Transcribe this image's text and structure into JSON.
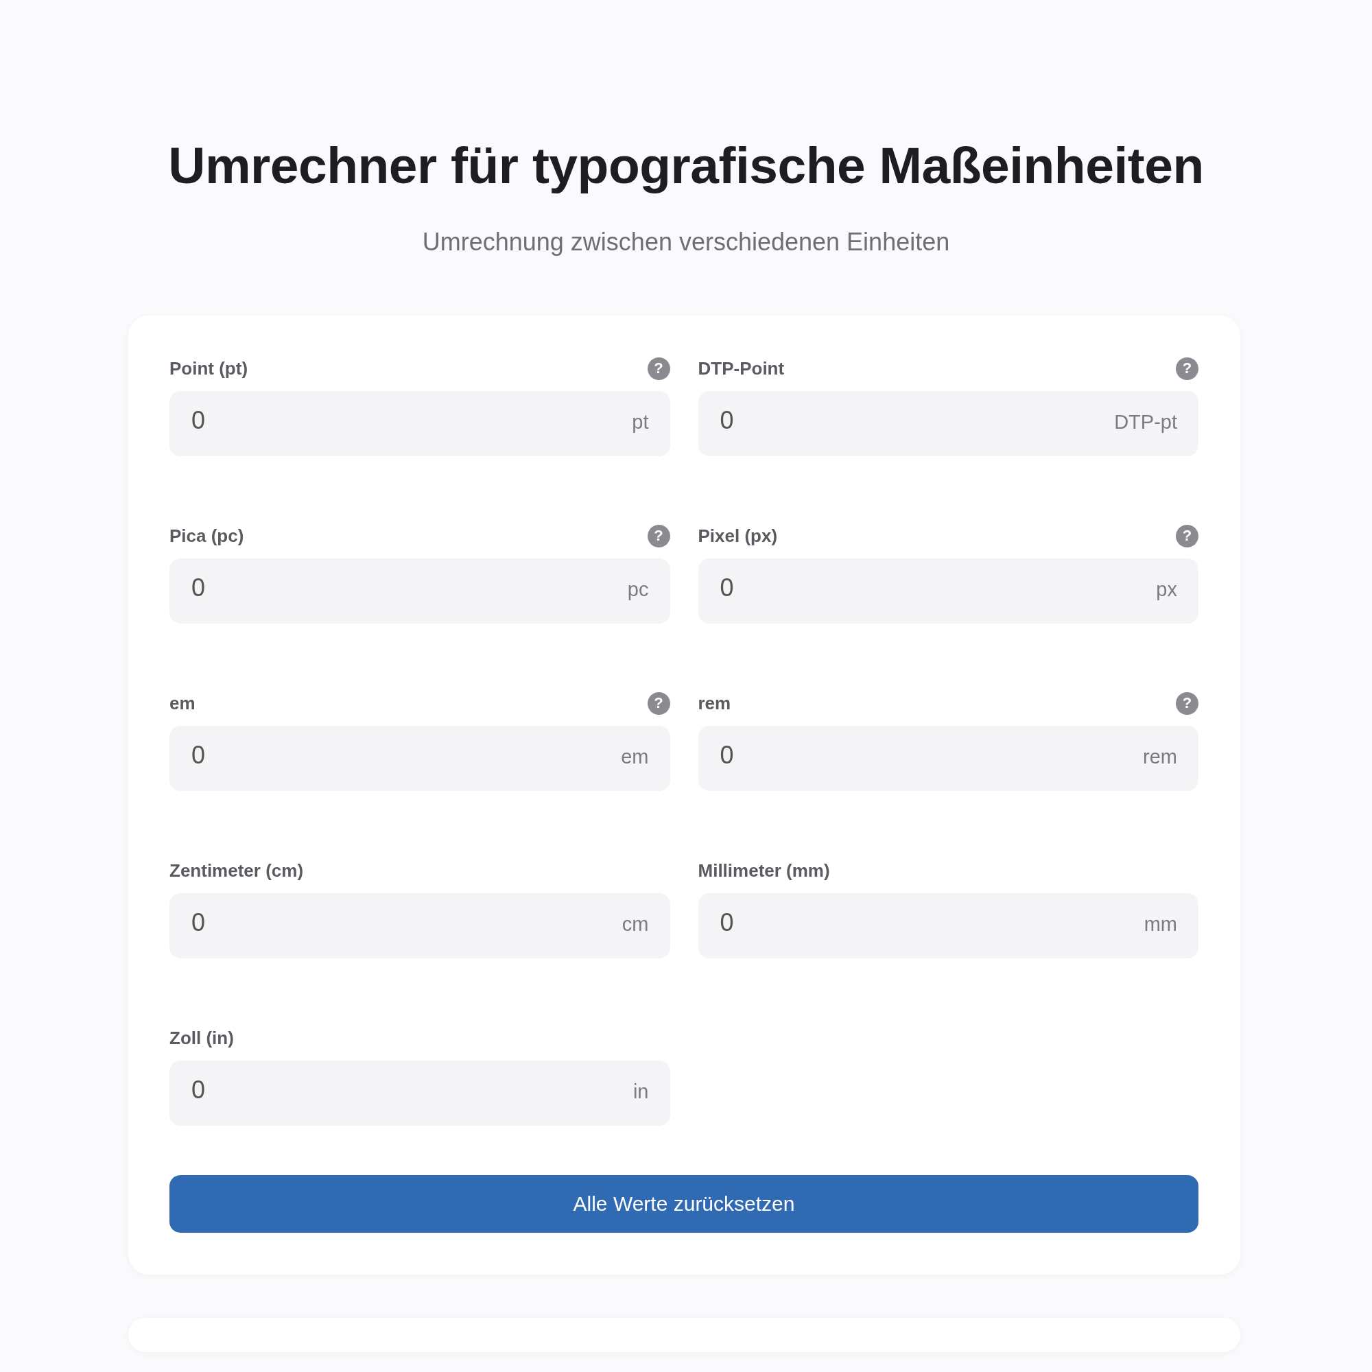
{
  "header": {
    "title": "Umrechner für typografische Maßeinheiten",
    "subtitle": "Umrechnung zwischen verschiedenen Einheiten"
  },
  "fields": [
    {
      "label": "Point (pt)",
      "help": "?",
      "value": "0",
      "unit": "pt"
    },
    {
      "label": "DTP-Point",
      "help": "?",
      "value": "0",
      "unit": "DTP-pt"
    },
    {
      "label": "Pica (pc)",
      "help": "?",
      "value": "0",
      "unit": "pc"
    },
    {
      "label": "Pixel (px)",
      "help": "?",
      "value": "0",
      "unit": "px"
    },
    {
      "label": "em",
      "help": "?",
      "value": "0",
      "unit": "em"
    },
    {
      "label": "rem",
      "help": "?",
      "value": "0",
      "unit": "rem"
    },
    {
      "label": "Zentimeter (cm)",
      "value": "0",
      "unit": "cm"
    },
    {
      "label": "Millimeter (mm)",
      "value": "0",
      "unit": "mm"
    },
    {
      "label": "Zoll (in)",
      "value": "0",
      "unit": "in"
    }
  ],
  "reset_button": "Alle Werte zurücksetzen"
}
